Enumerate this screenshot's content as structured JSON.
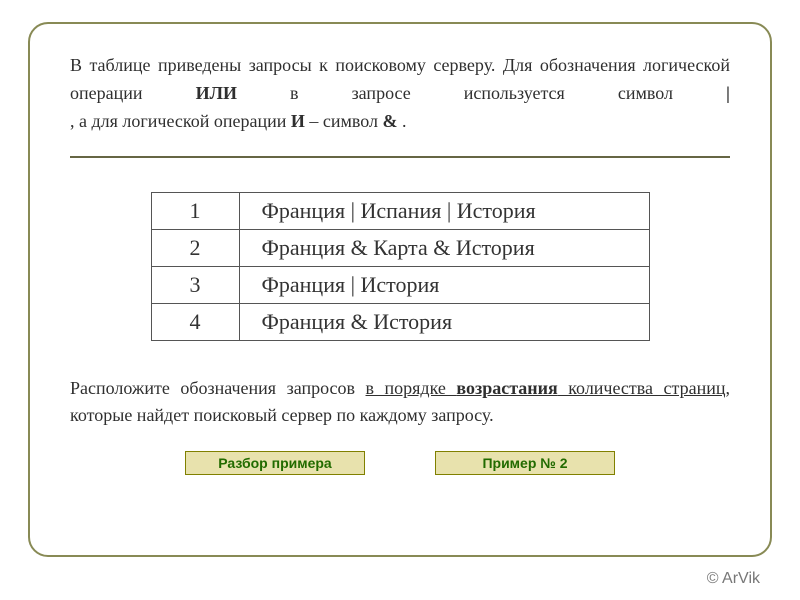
{
  "intro": {
    "line1_prefix": "В таблице приведены запросы к поисковому серверу. Для обозначения логической операции ",
    "or_word": "ИЛИ",
    "line1_mid": " в запросе используется символ ",
    "pipe_sym": "|",
    "line1_mid2": ", а для логической операции ",
    "and_word": "И",
    "line1_mid3": " – символ ",
    "amp_sym": "&",
    "line1_end": "."
  },
  "rows": [
    {
      "n": "1",
      "q": "Франция | Испания | История"
    },
    {
      "n": "2",
      "q": "Франция & Карта & История"
    },
    {
      "n": "3",
      "q": "Франция | История"
    },
    {
      "n": "4",
      "q": "Франция & История"
    }
  ],
  "task": {
    "prefix": "Расположите обозначения запросов ",
    "ul1": "в порядке ",
    "ulbold": "возрастания",
    "ul2": " количества страниц",
    "suffix": ", которые найдет поисковый сервер по каждому запросу."
  },
  "buttons": {
    "left": "Разбор примера",
    "right": "Пример № 2"
  },
  "copyright": "© ArVik"
}
